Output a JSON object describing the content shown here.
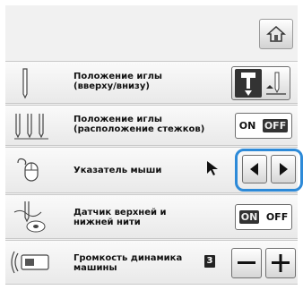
{
  "rows": [
    {
      "label": "Положение иглы\n(вверху/внизу)"
    },
    {
      "label": "Положение иглы\n(расположение стежков)",
      "on": "ON",
      "off": "OFF"
    },
    {
      "label": "Указатель мыши"
    },
    {
      "label": "Датчик верхней и\nнижней нити",
      "on": "ON",
      "off": "OFF"
    },
    {
      "label": "Громкость динамика\nмашины",
      "value": "3"
    }
  ],
  "icons": {
    "home": "home-icon",
    "needle": "needle-icon",
    "triple_needle": "needle-position-icon",
    "mouse": "mouse-icon",
    "thread": "thread-sensor-icon",
    "speaker": "speaker-icon",
    "pointer": "arrow-cursor-icon"
  },
  "colors": {
    "highlight": "#2d8ad8",
    "background": "#f1f1f1"
  }
}
